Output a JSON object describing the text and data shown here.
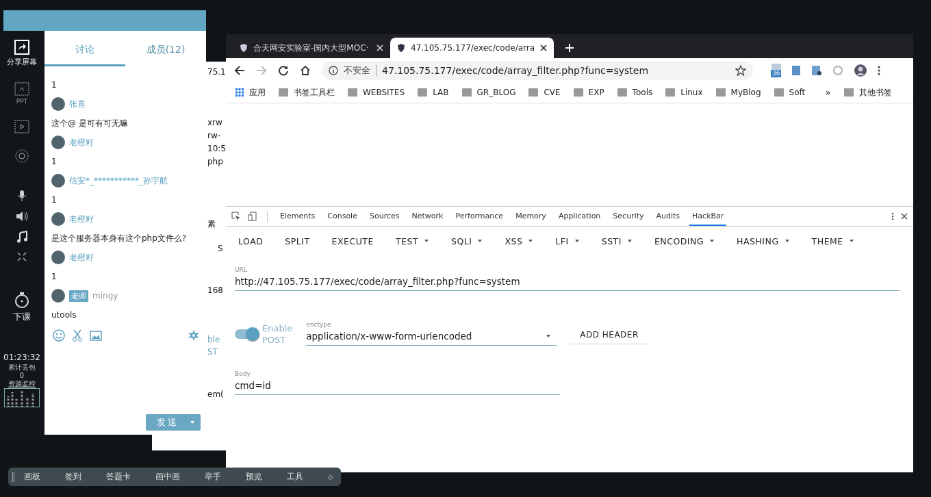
{
  "sidebar": {
    "share": "分享屏幕",
    "ppt": "PPT",
    "end_class": "下课",
    "timer": "01:23:32",
    "loss_label": "累计丢包",
    "loss_value": "0",
    "monitor": "资源监控"
  },
  "chat": {
    "tabs": [
      {
        "label": "讨论",
        "selected": true
      },
      {
        "label": "成员(12)",
        "selected": false
      }
    ],
    "messages": [
      {
        "kind": "text",
        "text": "1"
      },
      {
        "kind": "sender",
        "name": "张喜"
      },
      {
        "kind": "text",
        "text": "这个@  是可有可无嘛"
      },
      {
        "kind": "sender",
        "name": "老橙籽"
      },
      {
        "kind": "text",
        "text": "1"
      },
      {
        "kind": "sender",
        "name": "信安*_***********_孙宇航"
      },
      {
        "kind": "text",
        "text": "1"
      },
      {
        "kind": "sender",
        "name": "老橙籽"
      },
      {
        "kind": "text",
        "text": "是这个服务器本身有这个php文件么?"
      },
      {
        "kind": "sender",
        "name": "老橙籽"
      },
      {
        "kind": "text",
        "text": "1"
      },
      {
        "kind": "sender",
        "name": "mingy",
        "badge": "老师"
      },
      {
        "kind": "text",
        "text": "utools"
      }
    ],
    "send": "发送"
  },
  "background_window": {
    "fragments": [
      "75.1",
      "xrw",
      "rw-",
      "10:5",
      "php",
      "素",
      "S",
      "168",
      "ble",
      "ST",
      "em("
    ]
  },
  "browser": {
    "tabs": [
      {
        "title": "合天网安实验室-国内大型MOC·",
        "selected": false
      },
      {
        "title": "47.105.75.177/exec/code/arra",
        "selected": true
      }
    ],
    "security": "不安全",
    "address": "47.105.75.177/exec/code/array_filter.php?func=system",
    "extension_badge": "36",
    "bookmarks": [
      {
        "label": "应用",
        "kind": "apps"
      },
      {
        "label": "书签工具栏",
        "kind": "folder"
      },
      {
        "label": "WEBSITES",
        "kind": "folder"
      },
      {
        "label": "LAB",
        "kind": "folder"
      },
      {
        "label": "GR_BLOG",
        "kind": "folder"
      },
      {
        "label": "CVE",
        "kind": "folder"
      },
      {
        "label": "EXP",
        "kind": "folder"
      },
      {
        "label": "Tools",
        "kind": "folder"
      },
      {
        "label": "Linux",
        "kind": "folder"
      },
      {
        "label": "MyBlog",
        "kind": "folder"
      },
      {
        "label": "Soft",
        "kind": "folder"
      },
      {
        "label": "»",
        "kind": "more"
      },
      {
        "label": "其他书签",
        "kind": "folder"
      }
    ]
  },
  "devtools": {
    "tabs": [
      {
        "label": "Elements",
        "selected": false
      },
      {
        "label": "Console",
        "selected": false
      },
      {
        "label": "Sources",
        "selected": false
      },
      {
        "label": "Network",
        "selected": false
      },
      {
        "label": "Performance",
        "selected": false
      },
      {
        "label": "Memory",
        "selected": false
      },
      {
        "label": "Application",
        "selected": false
      },
      {
        "label": "Security",
        "selected": false
      },
      {
        "label": "Audits",
        "selected": false
      },
      {
        "label": "HackBar",
        "selected": true
      }
    ]
  },
  "hackbar": {
    "buttons": [
      {
        "label": "LOAD",
        "has_menu": false
      },
      {
        "label": "SPLIT",
        "has_menu": false
      },
      {
        "label": "EXECUTE",
        "has_menu": false
      },
      {
        "label": "TEST",
        "has_menu": true
      },
      {
        "label": "SQLI",
        "has_menu": true
      },
      {
        "label": "XSS",
        "has_menu": true
      },
      {
        "label": "LFI",
        "has_menu": true
      },
      {
        "label": "SSTI",
        "has_menu": true
      },
      {
        "label": "ENCODING",
        "has_menu": true
      },
      {
        "label": "HASHING",
        "has_menu": true
      },
      {
        "label": "THEME",
        "has_menu": true
      }
    ],
    "url_label": "URL",
    "url": "http://47.105.75.177/exec/code/array_filter.php?func=system",
    "post_toggle": {
      "label_1": "Enable",
      "label_2": "POST",
      "on": true
    },
    "enctype_label": "enctype",
    "enctype": "application/x-www-form-urlencoded",
    "add_header": "ADD HEADER",
    "body_label": "Body",
    "body": "cmd=id"
  },
  "classroom_toolbar": {
    "items": [
      "画板",
      "签到",
      "答题卡",
      "画中画",
      "举手",
      "预览",
      "工具"
    ]
  }
}
